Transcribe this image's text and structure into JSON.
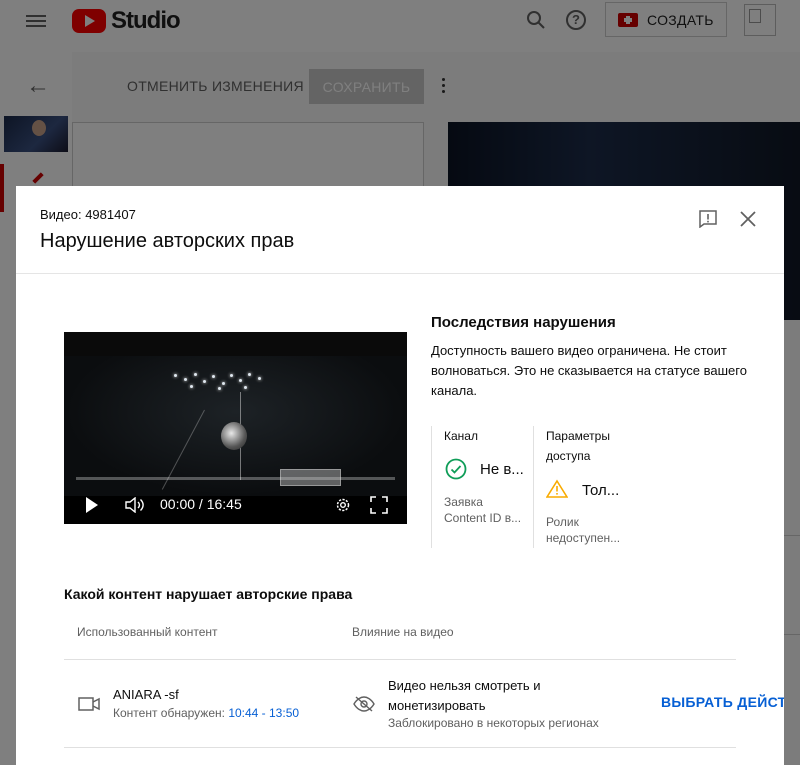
{
  "header": {
    "logo_text": "Studio",
    "create_label": "СОЗДАТЬ",
    "help_glyph": "?"
  },
  "editor": {
    "discard_label": "ОТМЕНИТЬ ИЗМЕНЕНИЯ",
    "save_label": "СОХРАНИТЬ"
  },
  "dialog": {
    "video_id": "Видео: 4981407",
    "title": "Нарушение авторских прав",
    "player": {
      "time": "00:00 / 16:45",
      "progress_fraction": 0.0
    },
    "consequences": {
      "title": "Последствия нарушения",
      "text": "Доступность вашего видео ограничена. Не стоит волноваться. Это не сказывается на статусе вашего канала.",
      "channel": {
        "label": "Канал",
        "status": "Не в...",
        "sub": "Заявка Content ID в..."
      },
      "access": {
        "label": "Параметры доступа",
        "status": "Тол...",
        "sub": "Ролик недоступен..."
      }
    },
    "claims": {
      "title": "Какой контент нарушает авторские права",
      "col_content": "Использованный контент",
      "col_impact": "Влияние на видео",
      "rows": [
        {
          "asset": "ANIARA -sf",
          "detected_prefix": "Контент обнаружен:",
          "detected_time": "10:44 - 13:50",
          "impact": "Видео нельзя смотреть и монетизировать",
          "impact_sub": "Заблокировано в некоторых регионах",
          "action": "ВЫБРАТЬ ДЕЙСТВ"
        }
      ]
    }
  },
  "colors": {
    "accent": "#065fd4",
    "brand_red": "#ff0000",
    "check_green": "#0f9d58",
    "warn_yellow": "#f9ab00"
  }
}
